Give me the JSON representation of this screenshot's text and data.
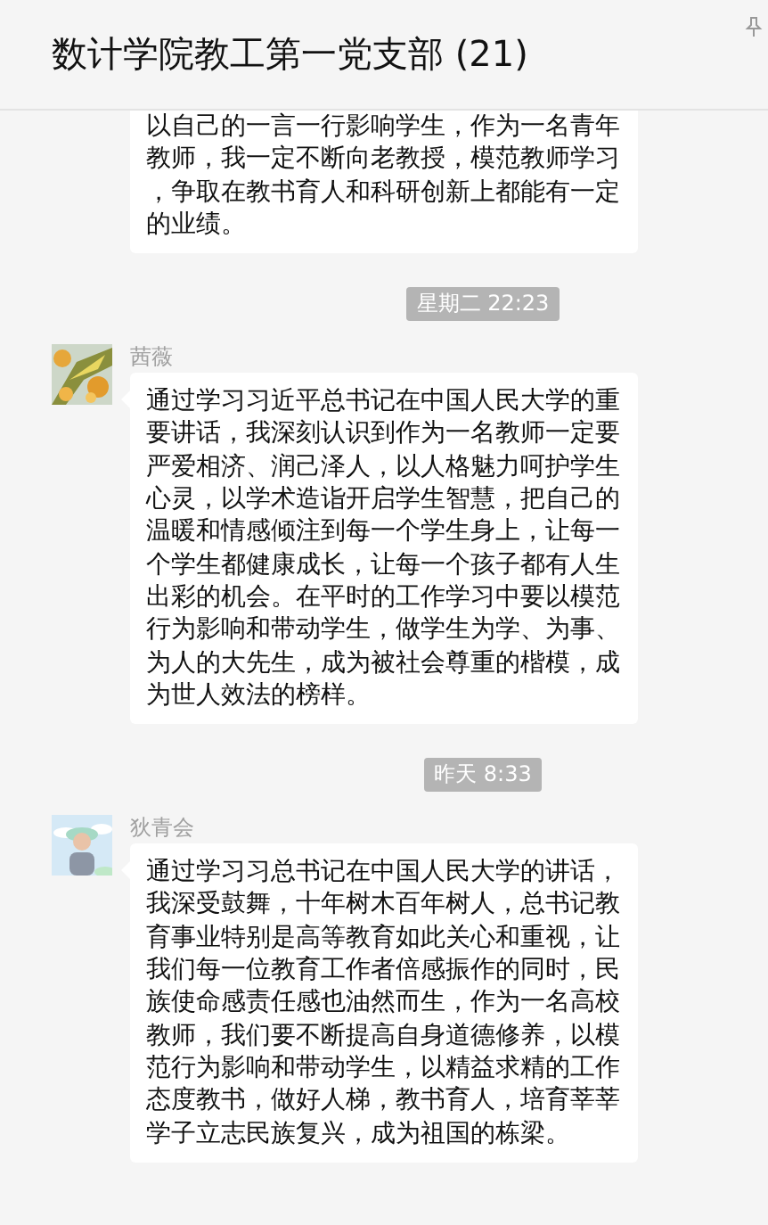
{
  "header": {
    "title": "数计学院教工第一党支部 (21)"
  },
  "messages": [
    {
      "kind": "continued",
      "text": "以自己的一言一行影响学生，作为一名青年教师，我一定不断向老教授，模范教师学习，争取在教书育人和科研创新上都能有一定的业绩。"
    },
    {
      "kind": "time",
      "text": "星期二 22:23"
    },
    {
      "kind": "message",
      "sender": "茜薇",
      "text": "通过学习习近平总书记在中国人民大学的重要讲话，我深刻认识到作为一名教师一定要严爱相济、润己泽人，以人格魅力呵护学生心灵，以学术造诣开启学生智慧，把自己的温暖和情感倾注到每一个学生身上，让每一个学生都健康成长，让每一个孩子都有人生出彩的机会。在平时的工作学习中要以模范行为影响和带动学生，做学生为学、为事、为人的大先生，成为被社会尊重的楷模，成为世人效法的榜样。"
    },
    {
      "kind": "time",
      "text": "昨天 8:33"
    },
    {
      "kind": "message",
      "sender": "狄青会",
      "text": "通过学习习总书记在中国人民大学的讲话，我深受鼓舞，十年树木百年树人，总书记教育事业特别是高等教育如此关心和重视，让我们每一位教育工作者倍感振作的同时，民族使命感责任感也油然而生，作为一名高校教师，我们要不断提高自身道德修养，以模范行为影响和带动学生，以精益求精的工作态度教书，做好人梯，教书育人，培育莘莘学子立志民族复兴，成为祖国的栋梁。"
    }
  ]
}
